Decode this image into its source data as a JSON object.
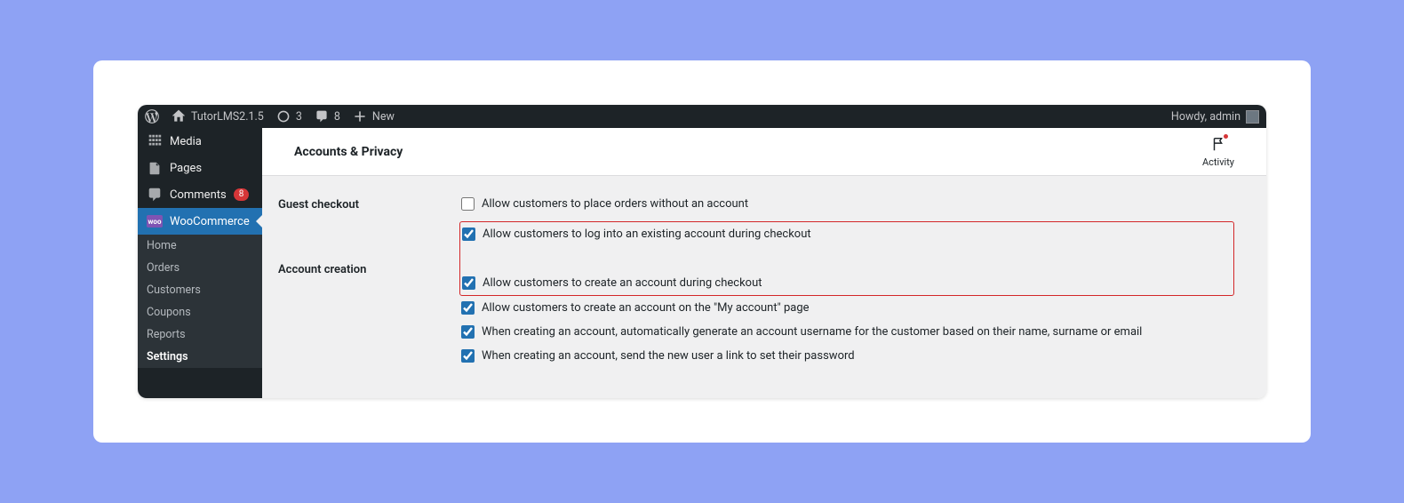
{
  "adminBar": {
    "siteName": "TutorLMS2.1.5",
    "updates": "3",
    "comments": "8",
    "newLabel": "New",
    "greeting": "Howdy, admin"
  },
  "sidebar": {
    "media": "Media",
    "pages": "Pages",
    "comments": "Comments",
    "commentsCount": "8",
    "woocommerce": "WooCommerce",
    "sub": {
      "home": "Home",
      "orders": "Orders",
      "customers": "Customers",
      "coupons": "Coupons",
      "reports": "Reports",
      "settings": "Settings"
    }
  },
  "page": {
    "title": "Accounts & Privacy",
    "activityLabel": "Activity"
  },
  "form": {
    "section1Label": "Guest checkout",
    "section2Label": "Account creation",
    "opt1": "Allow customers to place orders without an account",
    "opt2": "Allow customers to log into an existing account during checkout",
    "opt3": "Allow customers to create an account during checkout",
    "opt4": "Allow customers to create an account on the \"My account\" page",
    "opt5": "When creating an account, automatically generate an account username for the customer based on their name, surname or email",
    "opt6": "When creating an account, send the new user a link to set their password"
  }
}
